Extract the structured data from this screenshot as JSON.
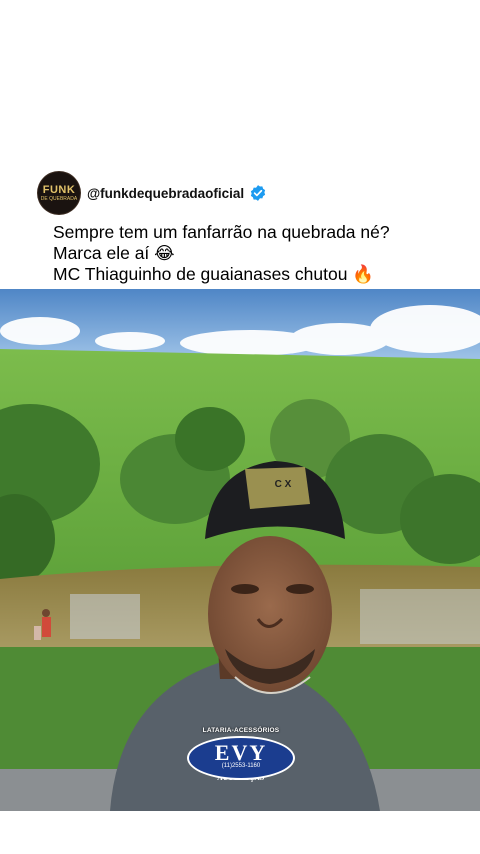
{
  "post": {
    "avatar_line1": "FUNK",
    "avatar_line2": "DE QUEBRADA",
    "handle": "@funkdequebradaoficial",
    "verified_icon": "verified-badge-icon",
    "caption_lines": [
      "Sempre tem um fanfarrão na quebrada né?",
      "Marca ele aí 😂",
      "MC Thiaguinho de guaianases chutou 🔥"
    ]
  },
  "video": {
    "cap_logo_text": "C X",
    "watermark": {
      "top": "LATARIA-ACESSÓRIOS",
      "main": "EVY",
      "phone": "(11)2553-1160",
      "bottom": "AUTOPEÇAS"
    }
  },
  "colors": {
    "verified_blue": "#1d9bf0",
    "sky": "#7fb2e2",
    "grass": "#6fb342"
  }
}
